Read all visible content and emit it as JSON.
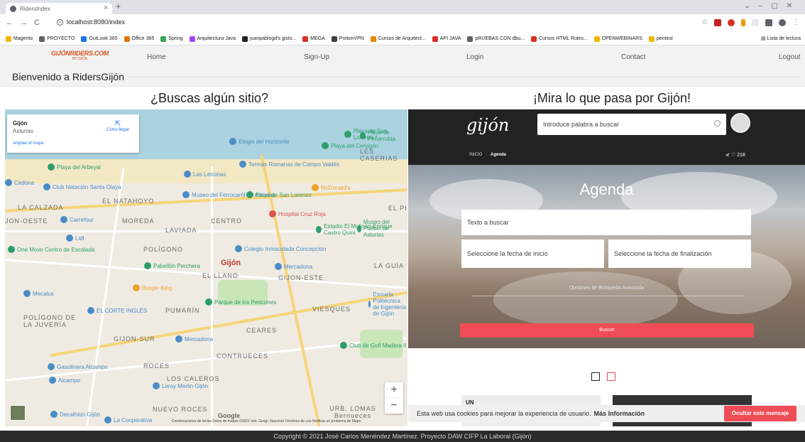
{
  "browser": {
    "tab_title": "RidersIndex",
    "tab_close": "×",
    "new_tab": "+",
    "url": "localhost:8080/index",
    "bookmarks": [
      {
        "label": "Magento",
        "color": "#f4b400"
      },
      {
        "label": "PROYECTO",
        "color": "#5f6368"
      },
      {
        "label": "OutLook 365",
        "color": "#1a73e8"
      },
      {
        "label": "Office 365",
        "color": "#e8710a"
      },
      {
        "label": "Spring",
        "color": "#34a853"
      },
      {
        "label": "Arquitectura Java",
        "color": "#a142f4"
      },
      {
        "label": "juanpablogd's gists...",
        "color": "#202124"
      },
      {
        "label": "MEGA",
        "color": "#d93025"
      },
      {
        "label": "ProtonVPN",
        "color": "#3c4043"
      },
      {
        "label": "Cursos de Arquitect...",
        "color": "#ea8600"
      },
      {
        "label": "API JAVA",
        "color": "#d93025"
      },
      {
        "label": "pRUEBAS CON dbu...",
        "color": "#5f6368"
      },
      {
        "label": "Cursos HTML Rules...",
        "color": "#d93025"
      },
      {
        "label": "OPENWEBINARS",
        "color": "#f4b400"
      },
      {
        "label": "pentest",
        "color": "#f4b400"
      }
    ],
    "reading_list": "Lista de lectura"
  },
  "nav": {
    "logo": "GIJÓNRIDERS.COM",
    "logo_sub": "BY GIJÓN",
    "home": "Home",
    "signup": "Sign-Up",
    "login": "Login",
    "contact": "Contact",
    "logout": "Logout"
  },
  "welcome": "Bienvenido a RidersGijón",
  "headings": {
    "left": "¿Buscas algún sitio?",
    "right": "¡Mira lo que pasa por Gijón!"
  },
  "map": {
    "place_name": "Gijón",
    "place_region": "Asturias",
    "directions": "Cómo llegar",
    "enlarge": "Ampliar el mapa",
    "city_label": "Gijón",
    "districts": [
      "LA CALZADA",
      "EL NATAHOYO",
      "CENTRO",
      "JON-OESTE",
      "MOREDA",
      "LAVIADA",
      "POLÍGONO",
      "EL LLANO",
      "GIJON-ESTE",
      "PUMARÍN",
      "CEARES",
      "VIESQUES",
      "GIJON-SUR",
      "CONTRUECES",
      "ROCES",
      "LOS CALEROS",
      "NUEVO ROCES",
      "POLÍGONO DE LA JUVERÍA",
      "LES CASERIAS",
      "LA GUÍA",
      "URB. LOMAS Bernueces",
      "EL PI"
    ],
    "pois": [
      "Elogio del Horizonte",
      "Playa de San Lorenzo",
      "Termas Romanas de Campo Valdés",
      "Las Letronas",
      "Museo del Ferrocarril de Asturias",
      "Playa de San Lorenzo",
      "McDonald's",
      "Hospital Cruz Roja",
      "Estadio El Molinón-Enrique Castro Quini",
      "Museo del Pueblo de Asturias",
      "Club Natación Santa Olaya",
      "Playa del Arbeyal",
      "Carrefour",
      "Lidl",
      "One Move Centro de Escalada",
      "Colegio Inmaculada Concepción",
      "Pabellón Perchera",
      "Mercadona",
      "Burger King",
      "Parque de los Pericones",
      "Mecalux",
      "EL CORTE INGLÉS",
      "Mercadona",
      "Club de Golf Madera II",
      "Gasolinera Alcampo",
      "Alcampo",
      "Leroy Merlin Gijón",
      "Decathlon Gijón",
      "La Cooperativa",
      "Escuela Politécnica de Ingeniería de Gijón",
      "Playa de Peñarrubia",
      "Playa del Cervigón",
      "Cadona"
    ],
    "zoom_in": "+",
    "zoom_out": "−",
    "google": "Google",
    "footer": "Combinaciones de teclas   Datos de mapas ©2021 Inst. Geogr. Nacional   Términos de uso   Notificar un problema de Maps"
  },
  "gijon": {
    "logo": "gijón",
    "search_placeholder": "Introduce palabra a buscar",
    "crumb_home": "INICIO",
    "crumb_current": "Agenda",
    "likes": "218",
    "title": "Agenda",
    "text_search": "Texto a buscar",
    "start_date": "Seleccione la fecha de inicio",
    "end_date": "Seleccione la fecha de finalización",
    "advanced": "Opciones de Búsqueda Avanzada",
    "search_button": "Buscar",
    "card_text": "UN"
  },
  "cookie": {
    "message": "Esta web usa cookies para mejorar la experiencia de usuario.",
    "more": "Más Información",
    "hide": "Ocultar este mensaje"
  },
  "footer": "Copyright © 2021 José Carlos Menéndez Martínez. Proyecto DAW CIFP La Laboral (Gijón)"
}
